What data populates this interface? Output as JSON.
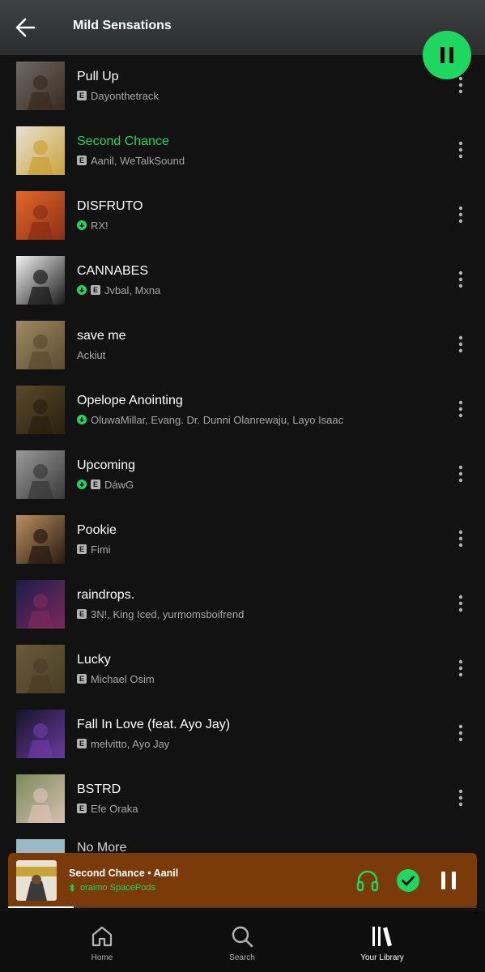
{
  "header": {
    "title": "Mild Sensations"
  },
  "tracks": [
    {
      "title": "Pull Up",
      "artists": "Dayonthetrack",
      "downloaded": false,
      "explicit": true,
      "active": false,
      "cover_colors": [
        "#6d6a64",
        "#3b2b20"
      ]
    },
    {
      "title": "Second Chance",
      "artists": "Aanil, WeTalkSound",
      "downloaded": false,
      "explicit": true,
      "active": true,
      "cover_colors": [
        "#e8e2d4",
        "#c9a23a"
      ]
    },
    {
      "title": "DISFRUTO",
      "artists": "RX!",
      "downloaded": true,
      "explicit": false,
      "active": false,
      "cover_colors": [
        "#e4682a",
        "#8b2f14"
      ]
    },
    {
      "title": "CANNABES",
      "artists": "Jvbal, Mxna",
      "downloaded": true,
      "explicit": true,
      "active": false,
      "cover_colors": [
        "#f2f2f2",
        "#1a1a1a"
      ]
    },
    {
      "title": "save me",
      "artists": "Ackiut",
      "downloaded": false,
      "explicit": false,
      "active": false,
      "cover_colors": [
        "#a08a62",
        "#5d4b32"
      ]
    },
    {
      "title": "Opelope Anointing",
      "artists": "OluwaMillar, Evang. Dr. Dunni Olanrewaju, Layo Isaac",
      "downloaded": true,
      "explicit": false,
      "active": false,
      "cover_colors": [
        "#5a4a2a",
        "#2a2010"
      ]
    },
    {
      "title": "Upcoming",
      "artists": "DáwG",
      "downloaded": true,
      "explicit": true,
      "active": false,
      "cover_colors": [
        "#9a9a9a",
        "#3a3a3a"
      ]
    },
    {
      "title": "Pookie",
      "artists": "Fimi",
      "downloaded": false,
      "explicit": true,
      "active": false,
      "cover_colors": [
        "#b89060",
        "#2a1a10"
      ]
    },
    {
      "title": "raindrops.",
      "artists": "3N!, King Iced, yurmomsboifrend",
      "downloaded": false,
      "explicit": true,
      "active": false,
      "cover_colors": [
        "#1b1c4a",
        "#7a2a5a"
      ]
    },
    {
      "title": "Lucky",
      "artists": "Michael Osim",
      "downloaded": false,
      "explicit": true,
      "active": false,
      "cover_colors": [
        "#6a5a3a",
        "#4a3e26"
      ]
    },
    {
      "title": "Fall In Love (feat. Ayo Jay)",
      "artists": "melvitto, Ayo Jay",
      "downloaded": false,
      "explicit": true,
      "active": false,
      "cover_colors": [
        "#141428",
        "#6a3aa0"
      ]
    },
    {
      "title": "BSTRD",
      "artists": "Efe Oraka",
      "downloaded": false,
      "explicit": true,
      "active": false,
      "cover_colors": [
        "#7a8a5a",
        "#d8c0b0"
      ]
    }
  ],
  "partial_track": {
    "title": "No More",
    "cover_colors": [
      "#9ab8c8",
      "#6a8898"
    ]
  },
  "now_playing": {
    "title": "Second Chance • Aanil",
    "device": "oraimo SpacePods",
    "progress_fraction": 0.14,
    "background_color": "#7a3a0a"
  },
  "nav": {
    "home": "Home",
    "search": "Search",
    "library": "Your Library"
  },
  "colors": {
    "accent": "#1ed760",
    "background": "#121212",
    "secondary_text": "#a7a7a7"
  }
}
